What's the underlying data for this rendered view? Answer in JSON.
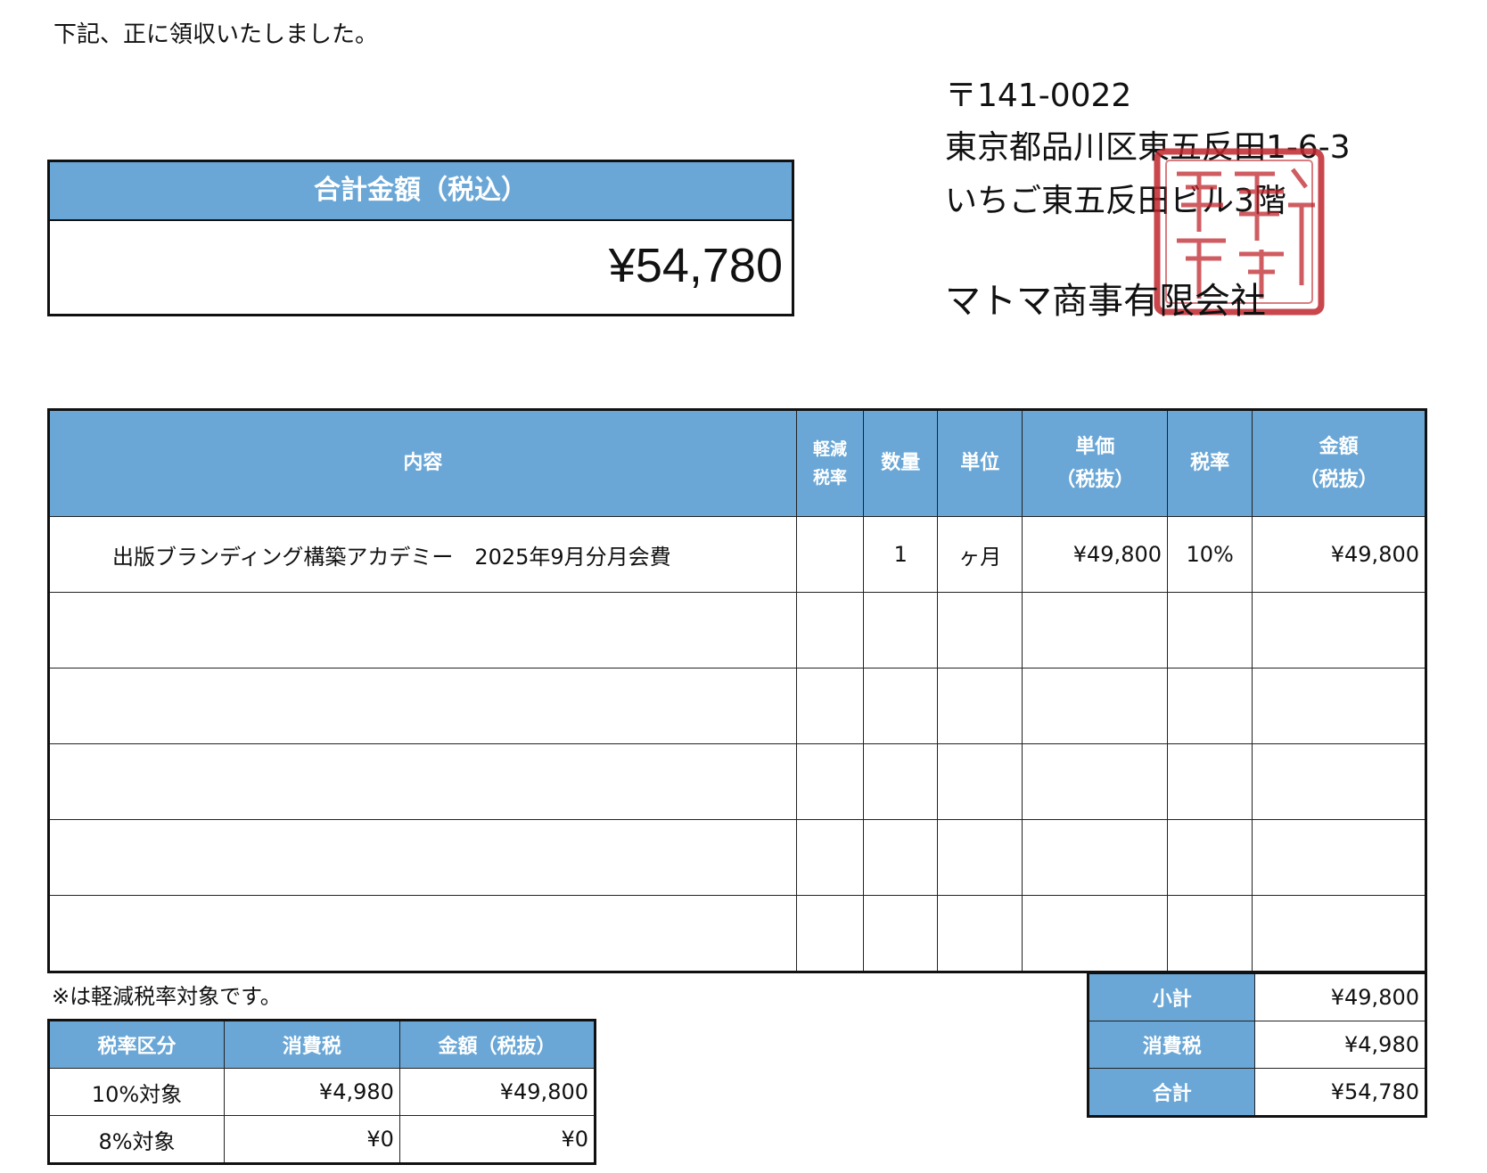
{
  "intro": "下記、正に領収いたしました。",
  "total": {
    "label": "合計金額（税込）",
    "value": "¥54,780"
  },
  "issuer": {
    "postal": "〒141-0022",
    "address1": "東京都品川区東五反田1-6-3",
    "address2": "いちご東五反田ビル3階",
    "company": "マトマ商事有限会社",
    "seal_text": "マトマ商事有限会社",
    "seal_color": "#c0262d"
  },
  "items_table": {
    "headers": {
      "description": "内容",
      "reduced_1": "軽減",
      "reduced_2": "税率",
      "quantity": "数量",
      "unit": "単位",
      "price_1": "単価",
      "price_2": "（税抜）",
      "tax_rate": "税率",
      "amount_1": "金額",
      "amount_2": "（税抜）"
    },
    "rows": [
      {
        "description": "出版ブランディング構築アカデミー　2025年9月分月会費",
        "reduced": "",
        "quantity": "1",
        "unit": "ヶ月",
        "unit_price": "¥49,800",
        "tax_rate": "10%",
        "amount": "¥49,800"
      },
      {
        "description": "",
        "reduced": "",
        "quantity": "",
        "unit": "",
        "unit_price": "",
        "tax_rate": "",
        "amount": ""
      },
      {
        "description": "",
        "reduced": "",
        "quantity": "",
        "unit": "",
        "unit_price": "",
        "tax_rate": "",
        "amount": ""
      },
      {
        "description": "",
        "reduced": "",
        "quantity": "",
        "unit": "",
        "unit_price": "",
        "tax_rate": "",
        "amount": ""
      },
      {
        "description": "",
        "reduced": "",
        "quantity": "",
        "unit": "",
        "unit_price": "",
        "tax_rate": "",
        "amount": ""
      },
      {
        "description": "",
        "reduced": "",
        "quantity": "",
        "unit": "",
        "unit_price": "",
        "tax_rate": "",
        "amount": ""
      }
    ]
  },
  "note": "※は軽減税率対象です。",
  "tax_table": {
    "headers": [
      "税率区分",
      "消費税",
      "金額（税抜）"
    ],
    "rows": [
      {
        "category": "10%対象",
        "tax": "¥4,980",
        "amount": "¥49,800"
      },
      {
        "category": "8%対象",
        "tax": "¥0",
        "amount": "¥0"
      }
    ]
  },
  "summary": {
    "subtotal_label": "小計",
    "subtotal": "¥49,800",
    "tax_label": "消費税",
    "tax": "¥4,980",
    "total_label": "合計",
    "total": "¥54,780"
  },
  "colors": {
    "header_bg": "#6aa7d6",
    "header_text": "#ffffff",
    "border": "#111111"
  }
}
